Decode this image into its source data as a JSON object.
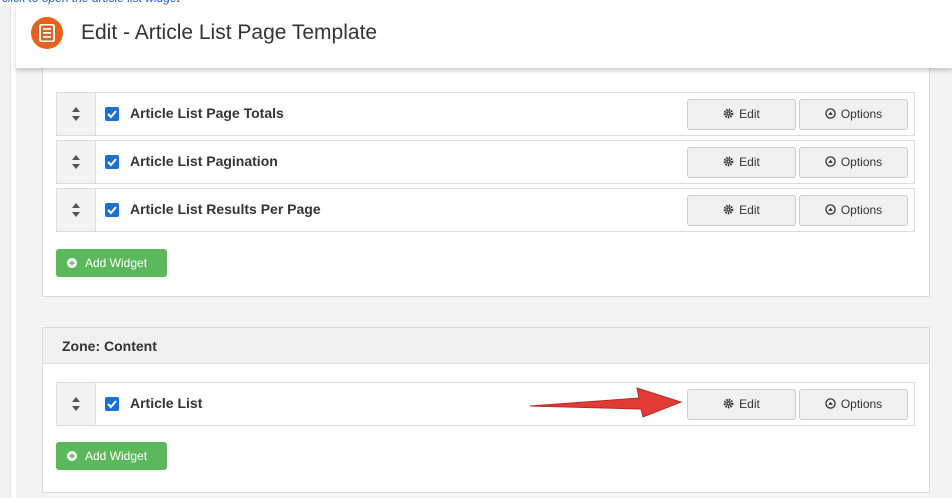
{
  "header": {
    "title": "Edit - Article List Page Template",
    "icon": "document-icon"
  },
  "zones": [
    {
      "title": "",
      "widgets": [
        {
          "label": "Article List Page Totals",
          "checked": true,
          "edit_label": "Edit",
          "options_label": "Options"
        },
        {
          "label": "Article List Pagination",
          "checked": true,
          "edit_label": "Edit",
          "options_label": "Options"
        },
        {
          "label": "Article List Results Per Page",
          "checked": true,
          "edit_label": "Edit",
          "options_label": "Options"
        }
      ],
      "add_widget_label": "Add Widget"
    },
    {
      "title": "Zone: Content",
      "widgets": [
        {
          "label": "Article List",
          "checked": true,
          "edit_label": "Edit",
          "options_label": "Options"
        }
      ],
      "add_widget_label": "Add Widget"
    }
  ],
  "colors": {
    "accent": "#e8611c",
    "checkbox": "#1a6fd6",
    "add_widget": "#5cb85c",
    "arrow": "#e23b35"
  }
}
